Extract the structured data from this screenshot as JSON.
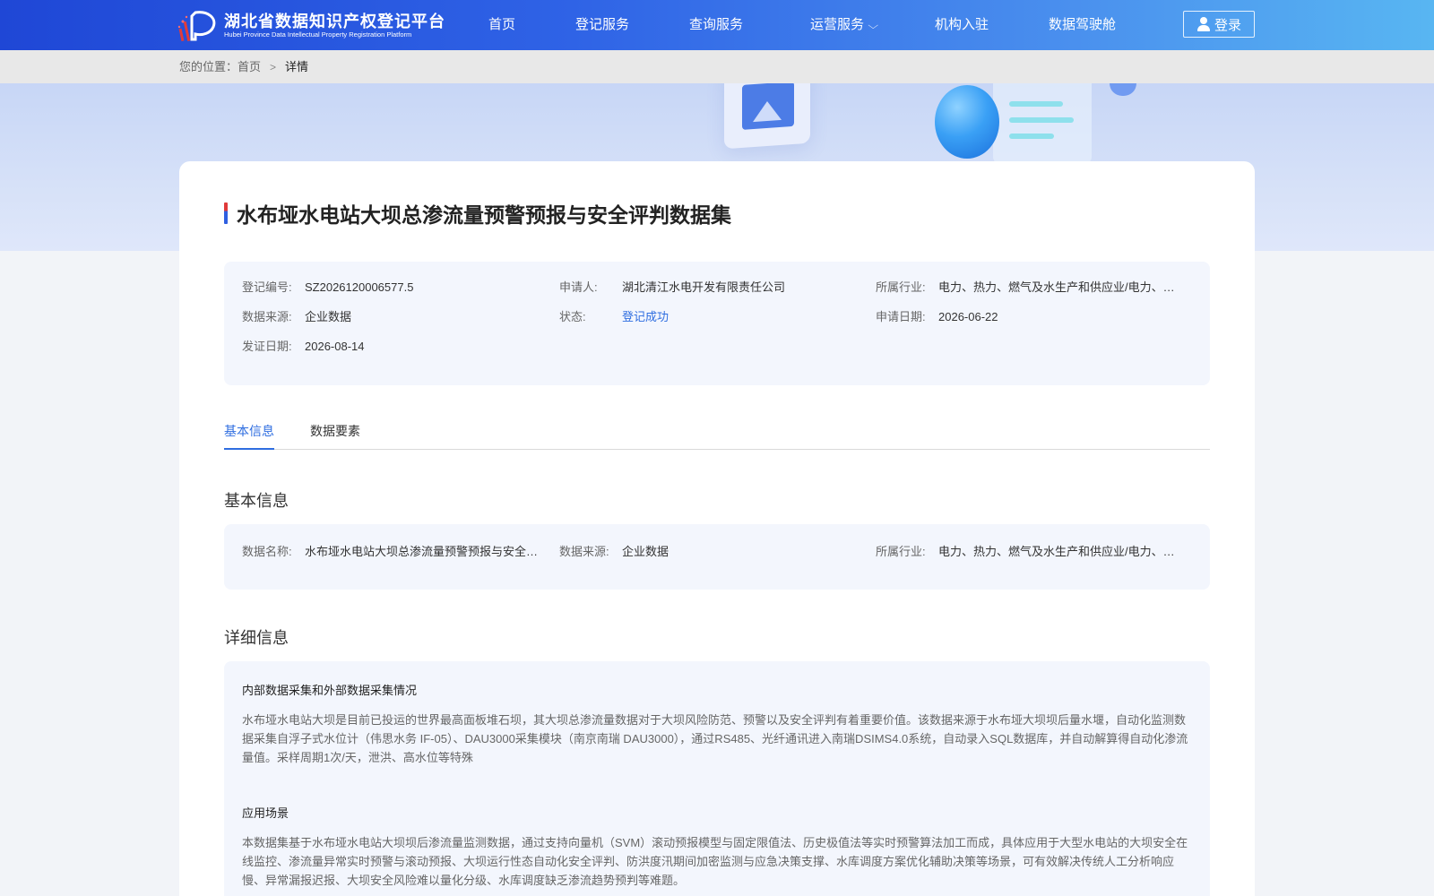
{
  "header": {
    "logo_cn": "湖北省数据知识产权登记平台",
    "logo_en": "Hubei Province Data Intellectual Property Registration Platform",
    "nav": [
      {
        "label": "首页"
      },
      {
        "label": "登记服务"
      },
      {
        "label": "查询服务"
      },
      {
        "label": "运营服务"
      },
      {
        "label": "机构入驻"
      },
      {
        "label": "数据驾驶舱"
      }
    ],
    "login_label": "登录"
  },
  "breadcrumb": {
    "prefix": "您的位置：",
    "home": "首页",
    "current": "详情"
  },
  "detail": {
    "title": "水布垭水电站大坝总渗流量预警预报与安全评判数据集",
    "summary": {
      "reg_no_label": "登记编号:",
      "reg_no": "SZ2026120006577.5",
      "applicant_label": "申请人:",
      "applicant": "湖北清江水电开发有限责任公司",
      "industry_label": "所属行业:",
      "industry": "电力、热力、燃气及水生产和供应业/电力、热力生产和供应业",
      "source_label": "数据来源:",
      "source": "企业数据",
      "status_label": "状态:",
      "status": "登记成功",
      "apply_date_label": "申请日期:",
      "apply_date": "2026-06-22",
      "issue_date_label": "发证日期:",
      "issue_date": "2026-08-14"
    },
    "tabs": [
      {
        "label": "基本信息"
      },
      {
        "label": "数据要素"
      }
    ],
    "basic": {
      "section_title": "基本信息",
      "name_label": "数据名称:",
      "name": "水布垭水电站大坝总渗流量预警预报与安全评判数据集",
      "source_label": "数据来源:",
      "source": "企业数据",
      "industry_label": "所属行业:",
      "industry": "电力、热力、燃气及水生产和供应业/电力、热力生产和供应业"
    },
    "more": {
      "section_title": "详细信息",
      "h1": "内部数据采集和外部数据采集情况",
      "p1": "水布垭水电站大坝是目前已投运的世界最高面板堆石坝，其大坝总渗流量数据对于大坝风险防范、预警以及安全评判有着重要价值。该数据来源于水布垭大坝坝后量水堰，自动化监测数据采集自浮子式水位计（伟思水务 IF-05）、DAU3000采集模块（南京南瑞 DAU3000），通过RS485、光纤通讯进入南瑞DSIMS4.0系统，自动录入SQL数据库，并自动解算得自动化渗流量值。采样周期1次/天，泄洪、高水位等特殊",
      "h2": "应用场景",
      "p2": "本数据集基于水布垭水电站大坝坝后渗流量监测数据，通过支持向量机（SVM）滚动预报模型与固定限值法、历史极值法等实时预警算法加工而成，具体应用于大型水电站的大坝安全在线监控、渗流量异常实时预警与滚动预报、大坝运行性态自动化安全评判、防洪度汛期间加密监测与应急决策支撑、水库调度方案优化辅助决策等场景，可有效解决传统人工分析响应慢、异常漏报迟报、大坝安全风险难以量化分级、水库调度缺乏渗流趋势预判等难题。"
    }
  }
}
